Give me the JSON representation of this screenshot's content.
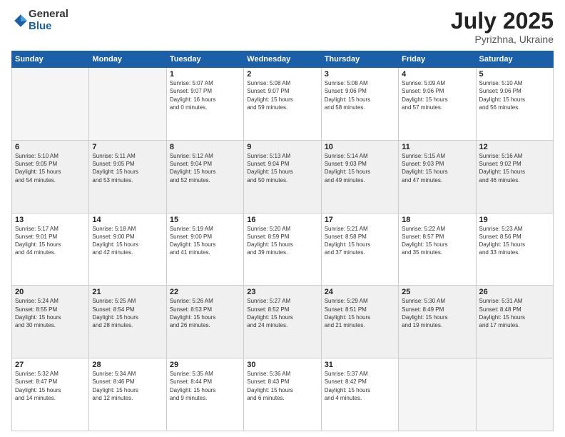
{
  "header": {
    "logo_general": "General",
    "logo_blue": "Blue",
    "month": "July 2025",
    "location": "Pyrizhna, Ukraine"
  },
  "days_of_week": [
    "Sunday",
    "Monday",
    "Tuesday",
    "Wednesday",
    "Thursday",
    "Friday",
    "Saturday"
  ],
  "weeks": [
    [
      {
        "day": "",
        "info": ""
      },
      {
        "day": "",
        "info": ""
      },
      {
        "day": "1",
        "info": "Sunrise: 5:07 AM\nSunset: 9:07 PM\nDaylight: 16 hours\nand 0 minutes."
      },
      {
        "day": "2",
        "info": "Sunrise: 5:08 AM\nSunset: 9:07 PM\nDaylight: 15 hours\nand 59 minutes."
      },
      {
        "day": "3",
        "info": "Sunrise: 5:08 AM\nSunset: 9:06 PM\nDaylight: 15 hours\nand 58 minutes."
      },
      {
        "day": "4",
        "info": "Sunrise: 5:09 AM\nSunset: 9:06 PM\nDaylight: 15 hours\nand 57 minutes."
      },
      {
        "day": "5",
        "info": "Sunrise: 5:10 AM\nSunset: 9:06 PM\nDaylight: 15 hours\nand 56 minutes."
      }
    ],
    [
      {
        "day": "6",
        "info": "Sunrise: 5:10 AM\nSunset: 9:05 PM\nDaylight: 15 hours\nand 54 minutes."
      },
      {
        "day": "7",
        "info": "Sunrise: 5:11 AM\nSunset: 9:05 PM\nDaylight: 15 hours\nand 53 minutes."
      },
      {
        "day": "8",
        "info": "Sunrise: 5:12 AM\nSunset: 9:04 PM\nDaylight: 15 hours\nand 52 minutes."
      },
      {
        "day": "9",
        "info": "Sunrise: 5:13 AM\nSunset: 9:04 PM\nDaylight: 15 hours\nand 50 minutes."
      },
      {
        "day": "10",
        "info": "Sunrise: 5:14 AM\nSunset: 9:03 PM\nDaylight: 15 hours\nand 49 minutes."
      },
      {
        "day": "11",
        "info": "Sunrise: 5:15 AM\nSunset: 9:03 PM\nDaylight: 15 hours\nand 47 minutes."
      },
      {
        "day": "12",
        "info": "Sunrise: 5:16 AM\nSunset: 9:02 PM\nDaylight: 15 hours\nand 46 minutes."
      }
    ],
    [
      {
        "day": "13",
        "info": "Sunrise: 5:17 AM\nSunset: 9:01 PM\nDaylight: 15 hours\nand 44 minutes."
      },
      {
        "day": "14",
        "info": "Sunrise: 5:18 AM\nSunset: 9:00 PM\nDaylight: 15 hours\nand 42 minutes."
      },
      {
        "day": "15",
        "info": "Sunrise: 5:19 AM\nSunset: 9:00 PM\nDaylight: 15 hours\nand 41 minutes."
      },
      {
        "day": "16",
        "info": "Sunrise: 5:20 AM\nSunset: 8:59 PM\nDaylight: 15 hours\nand 39 minutes."
      },
      {
        "day": "17",
        "info": "Sunrise: 5:21 AM\nSunset: 8:58 PM\nDaylight: 15 hours\nand 37 minutes."
      },
      {
        "day": "18",
        "info": "Sunrise: 5:22 AM\nSunset: 8:57 PM\nDaylight: 15 hours\nand 35 minutes."
      },
      {
        "day": "19",
        "info": "Sunrise: 5:23 AM\nSunset: 8:56 PM\nDaylight: 15 hours\nand 33 minutes."
      }
    ],
    [
      {
        "day": "20",
        "info": "Sunrise: 5:24 AM\nSunset: 8:55 PM\nDaylight: 15 hours\nand 30 minutes."
      },
      {
        "day": "21",
        "info": "Sunrise: 5:25 AM\nSunset: 8:54 PM\nDaylight: 15 hours\nand 28 minutes."
      },
      {
        "day": "22",
        "info": "Sunrise: 5:26 AM\nSunset: 8:53 PM\nDaylight: 15 hours\nand 26 minutes."
      },
      {
        "day": "23",
        "info": "Sunrise: 5:27 AM\nSunset: 8:52 PM\nDaylight: 15 hours\nand 24 minutes."
      },
      {
        "day": "24",
        "info": "Sunrise: 5:29 AM\nSunset: 8:51 PM\nDaylight: 15 hours\nand 21 minutes."
      },
      {
        "day": "25",
        "info": "Sunrise: 5:30 AM\nSunset: 8:49 PM\nDaylight: 15 hours\nand 19 minutes."
      },
      {
        "day": "26",
        "info": "Sunrise: 5:31 AM\nSunset: 8:48 PM\nDaylight: 15 hours\nand 17 minutes."
      }
    ],
    [
      {
        "day": "27",
        "info": "Sunrise: 5:32 AM\nSunset: 8:47 PM\nDaylight: 15 hours\nand 14 minutes."
      },
      {
        "day": "28",
        "info": "Sunrise: 5:34 AM\nSunset: 8:46 PM\nDaylight: 15 hours\nand 12 minutes."
      },
      {
        "day": "29",
        "info": "Sunrise: 5:35 AM\nSunset: 8:44 PM\nDaylight: 15 hours\nand 9 minutes."
      },
      {
        "day": "30",
        "info": "Sunrise: 5:36 AM\nSunset: 8:43 PM\nDaylight: 15 hours\nand 6 minutes."
      },
      {
        "day": "31",
        "info": "Sunrise: 5:37 AM\nSunset: 8:42 PM\nDaylight: 15 hours\nand 4 minutes."
      },
      {
        "day": "",
        "info": ""
      },
      {
        "day": "",
        "info": ""
      }
    ]
  ]
}
